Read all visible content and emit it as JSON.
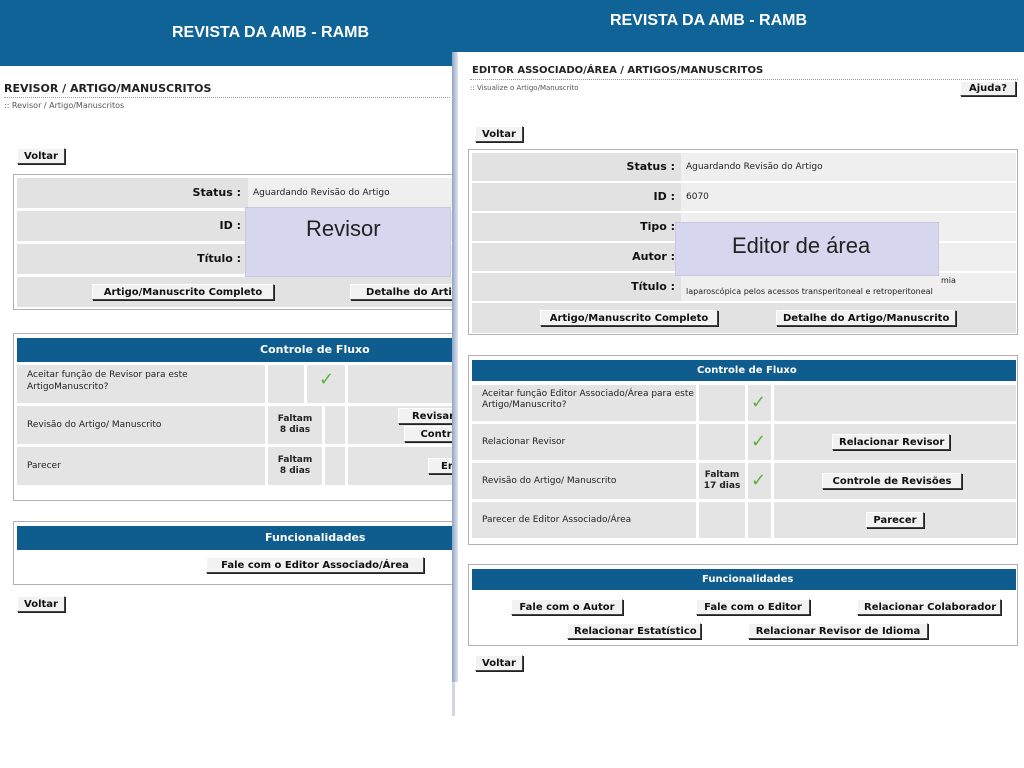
{
  "banner": {
    "title_left": "REVISTA DA AMB - RAMB",
    "title_right": "REVISTA DA AMB - RAMB"
  },
  "left": {
    "heading": "REVISOR / ARTIGO/MANUSCRITOS",
    "breadcrumb": ":: Revisor / Artigo/Manuscritos",
    "voltar": "Voltar",
    "status_label": "Status :",
    "status_value": "Aguardando Revisão do Artigo",
    "id_label": "ID :",
    "titulo_label": "Título :",
    "btn_completo": "Artigo/Manuscrito Completo",
    "btn_detalhe": "Detalhe do Artig",
    "overlay": "Revisor",
    "flow_title": "Controle de Fluxo",
    "flow_rows": [
      {
        "label": "Aceitar função de Revisor para este ArtigoManuscrito?"
      },
      {
        "label": "Revisão do Artigo/ Manuscrito",
        "faltam": "Faltam",
        "dias": "8 dias",
        "btn1": "Revisar",
        "btn2": "Contr"
      },
      {
        "label": "Parecer",
        "faltam": "Faltam",
        "dias": "8 dias",
        "btn1": "En"
      }
    ],
    "func_title": "Funcionalidades",
    "func_btn": "Fale com o Editor Associado/Área",
    "voltar_bottom": "Voltar"
  },
  "right": {
    "heading": "EDITOR ASSOCIADO/ÁREA / ARTIGOS/MANUSCRITOS",
    "breadcrumb": ":: Visualize o Artigo/Manuscrito",
    "ajuda": "Ajuda?",
    "voltar": "Voltar",
    "status_label": "Status :",
    "status_value": "Aguardando Revisão do Artigo",
    "id_label": "ID :",
    "id_value": "6070",
    "tipo_label": "Tipo :",
    "autor_label": "Autor :",
    "titulo_label": "Título :",
    "titulo_line1": "mia",
    "titulo_line2": "laparoscópica pelos acessos transperitoneal e retroperitoneal",
    "btn_completo": "Artigo/Manuscrito Completo",
    "btn_detalhe": "Detalhe do Artigo/Manuscrito",
    "overlay": "Editor de área",
    "flow_title": "Controle de Fluxo",
    "flow_rows": [
      {
        "label": "Aceitar função Editor Associado/Área para este Artigo/Manuscrito?"
      },
      {
        "label": "Relacionar Revisor",
        "btn": "Relacionar Revisor"
      },
      {
        "label": "Revisão do Artigo/ Manuscrito",
        "faltam": "Faltam",
        "dias": "17 dias",
        "btn": "Controle de Revisões"
      },
      {
        "label": "Parecer de Editor Associado/Área",
        "btn": "Parecer"
      }
    ],
    "func_title": "Funcionalidades",
    "func_buttons": [
      "Fale com o Autor",
      "Fale com o Editor",
      "Relacionar Colaborador",
      "Relacionar Estatístico",
      "Relacionar Revisor de Idioma"
    ],
    "voltar_bottom": "Voltar"
  },
  "icons": {
    "check": "check-icon"
  }
}
